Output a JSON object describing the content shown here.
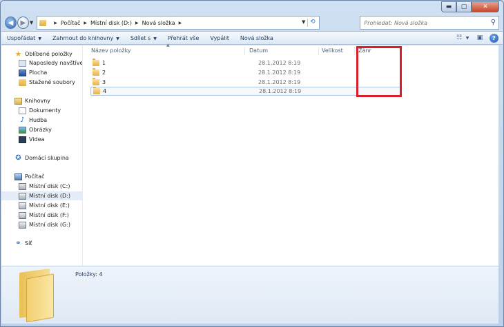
{
  "window": {
    "caption_buttons": {
      "minimize": "▬",
      "maximize": "▢",
      "close": "✕"
    }
  },
  "address": {
    "back_icon": "◀",
    "forward_icon": "▶",
    "breadcrumbs": [
      "Počítač",
      "Místní disk (D:)",
      "Nová složka"
    ]
  },
  "search": {
    "placeholder": "Prohledat: Nová složka"
  },
  "toolbar": {
    "items": [
      "Uspořádat",
      "Zahrnout do knihovny",
      "Sdílet s",
      "Přehrát vše",
      "Vypálit",
      "Nová složka"
    ]
  },
  "nav": {
    "favorites": "Oblíbené položky",
    "recent": "Naposledy navštívené",
    "desktop": "Plocha",
    "downloads": "Stažené soubory",
    "libraries": "Knihovny",
    "documents": "Dokumenty",
    "music": "Hudba",
    "pictures": "Obrázky",
    "videos": "Videa",
    "homegroup": "Domácí skupina",
    "computer": "Počítač",
    "disk_c": "Místní disk (C:)",
    "disk_d": "Místní disk (D:)",
    "disk_e": "Místní disk (E:)",
    "disk_f": "Místní disk (F:)",
    "disk_g": "Místní disk (G:)",
    "network": "Síť"
  },
  "columns": {
    "name": "Název položky",
    "date": "Datum",
    "size": "Velikost",
    "genre": "Žánr"
  },
  "rows": [
    {
      "name": "1",
      "date": "28.1.2012 8:19"
    },
    {
      "name": "2",
      "date": "28.1.2012 8:19"
    },
    {
      "name": "3",
      "date": "28.1.2012 8:19"
    },
    {
      "name": "4",
      "date": "28.1.2012 8:19"
    }
  ],
  "details": {
    "items_label": "Položky: 4"
  },
  "colors": {
    "highlight": "#d61f26",
    "selection_border": "#a9c4e4"
  }
}
